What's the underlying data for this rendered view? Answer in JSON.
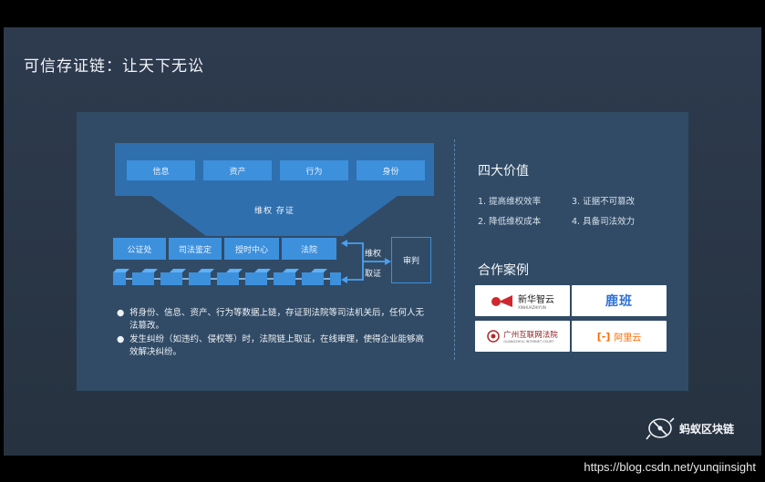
{
  "title": "可信存证链：让天下无讼",
  "diagram": {
    "top_items": [
      "信息",
      "资产",
      "行为",
      "身份"
    ],
    "funnel_label": "维权  存证",
    "nodes": [
      "公证处",
      "司法鉴定",
      "授时中心",
      "法院"
    ],
    "right_labels": [
      "维权",
      "取证"
    ],
    "judge": "审判",
    "bullets": [
      "将身份、信息、资产、行为等数据上链，存证到法院等司法机关后，任何人无法篡改。",
      "发生纠纷（如违约、侵权等）时，法院链上取证，在线审理，使得企业能够高效解决纠纷。"
    ]
  },
  "values": {
    "heading": "四大价值",
    "items": [
      "1. 提高维权效率",
      "3. 证据不可篡改",
      "2. 降低维权成本",
      "4. 具备司法效力"
    ]
  },
  "partners": {
    "heading": "合作案例",
    "items": [
      {
        "name": "新华智云",
        "sub": "XINHUAZHIYUN"
      },
      {
        "name": "鹿班"
      },
      {
        "name": "广州互联网法院",
        "sub": "GUANGZHOU INTERNET COURT"
      },
      {
        "name": "阿里云"
      }
    ]
  },
  "brand": "蚂蚁区块链",
  "watermark": "https://blog.csdn.net/yunqiinsight",
  "colors": {
    "accent": "#3d90dc",
    "panel": "#314b66",
    "background": "#2b3747"
  }
}
